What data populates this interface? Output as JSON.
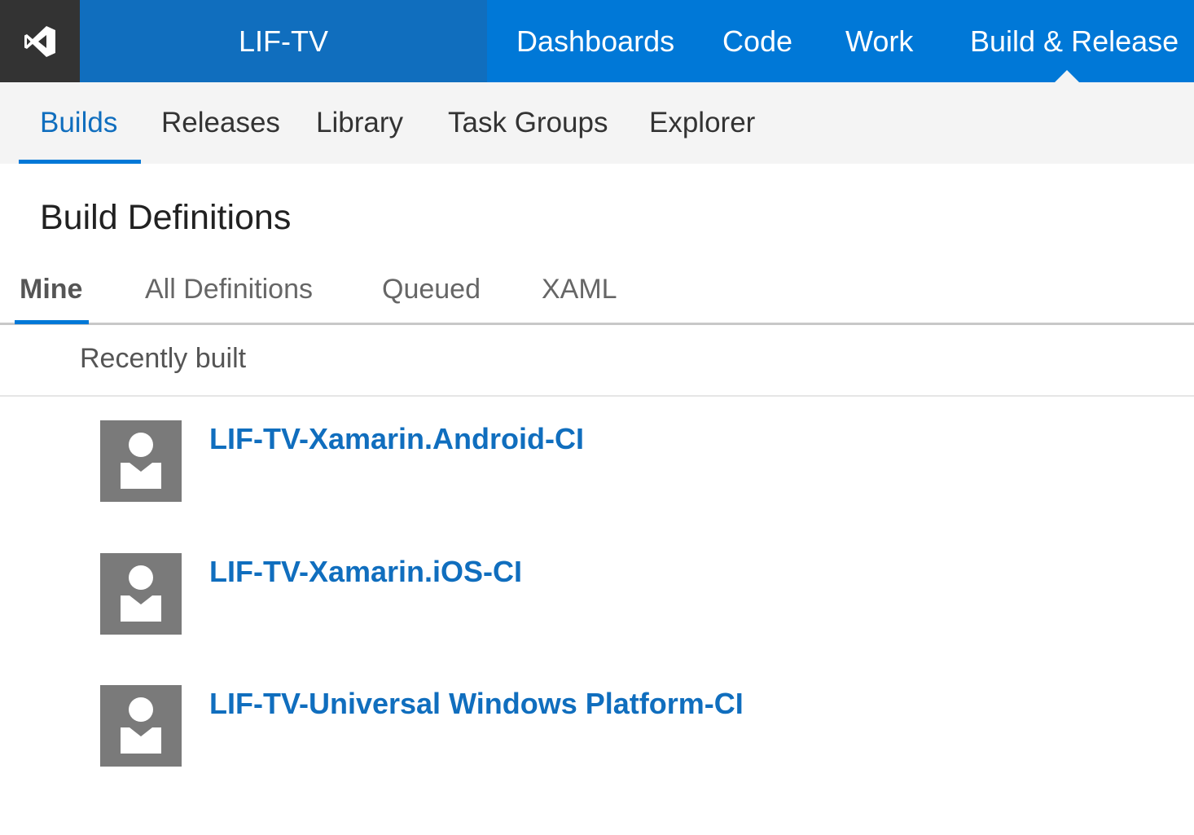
{
  "header": {
    "logo_icon": "visual-studio-logo-icon",
    "project_name": "LIF-TV",
    "hubs": [
      {
        "label": "Dashboards"
      },
      {
        "label": "Code"
      },
      {
        "label": "Work"
      },
      {
        "label": "Build & Release",
        "selected": true
      }
    ],
    "colors": {
      "bar": "#0078d7",
      "project": "#106ebe",
      "logo_bg": "#333333"
    }
  },
  "subnav": {
    "items": [
      {
        "label": "Builds",
        "selected": true
      },
      {
        "label": "Releases"
      },
      {
        "label": "Library"
      },
      {
        "label": "Task Groups"
      },
      {
        "label": "Explorer"
      }
    ]
  },
  "page": {
    "title": "Build Definitions"
  },
  "pivots": {
    "items": [
      {
        "label": "Mine",
        "selected": true
      },
      {
        "label": "All Definitions"
      },
      {
        "label": "Queued"
      },
      {
        "label": "XAML"
      }
    ]
  },
  "group": {
    "header": "Recently built"
  },
  "definitions": [
    {
      "name": "LIF-TV-Xamarin.Android-CI",
      "avatar_icon": "person-icon"
    },
    {
      "name": "LIF-TV-Xamarin.iOS-CI",
      "avatar_icon": "person-icon"
    },
    {
      "name": "LIF-TV-Universal Windows Platform-CI",
      "avatar_icon": "person-icon"
    }
  ]
}
